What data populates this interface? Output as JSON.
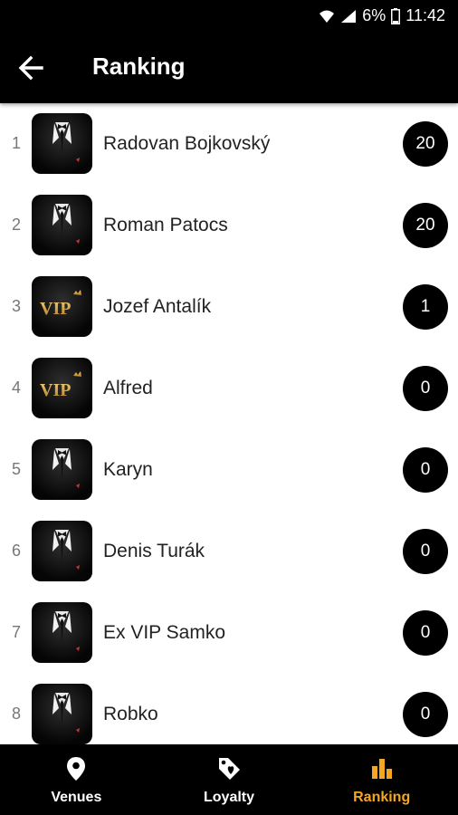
{
  "status_bar": {
    "battery_percent": "6%",
    "time": "11:42"
  },
  "header": {
    "title": "Ranking"
  },
  "ranking": [
    {
      "rank": "1",
      "name": "Radovan Bojkovský",
      "score": "20",
      "avatar": "tuxedo"
    },
    {
      "rank": "2",
      "name": "Roman Patocs",
      "score": "20",
      "avatar": "tuxedo"
    },
    {
      "rank": "3",
      "name": "Jozef Antalík",
      "score": "1",
      "avatar": "vip",
      "avatar_text": "VIP"
    },
    {
      "rank": "4",
      "name": "Alfred",
      "score": "0",
      "avatar": "vip",
      "avatar_text": "VIP"
    },
    {
      "rank": "5",
      "name": "Karyn",
      "score": "0",
      "avatar": "tuxedo"
    },
    {
      "rank": "6",
      "name": "Denis Turák",
      "score": "0",
      "avatar": "tuxedo"
    },
    {
      "rank": "7",
      "name": "Ex VIP Samko",
      "score": "0",
      "avatar": "tuxedo"
    },
    {
      "rank": "8",
      "name": "Robko",
      "score": "0",
      "avatar": "tuxedo"
    }
  ],
  "bottom_nav": [
    {
      "label": "Venues",
      "icon": "location-pin-icon",
      "active": false
    },
    {
      "label": "Loyalty",
      "icon": "tag-icon",
      "active": false
    },
    {
      "label": "Ranking",
      "icon": "bar-chart-icon",
      "active": true
    }
  ],
  "colors": {
    "bar": "#000000",
    "active_tab": "#f5a623",
    "inactive_tab": "#ffffff",
    "vip_gold": "#d9a441",
    "rank_text": "#777777"
  }
}
